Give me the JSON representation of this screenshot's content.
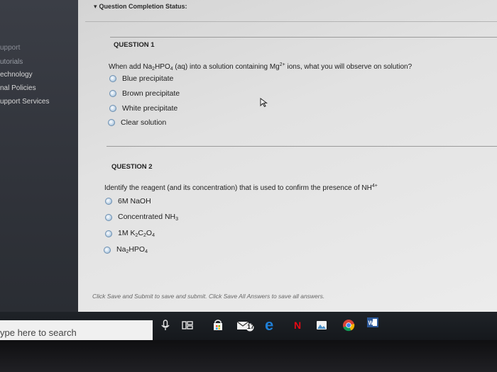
{
  "status": {
    "label": "Question Completion Status:"
  },
  "sidebar": {
    "items": [
      {
        "label": "upport"
      },
      {
        "label": "utorials"
      },
      {
        "label": "echnology"
      },
      {
        "label": "nal Policies"
      },
      {
        "label": "upport Services"
      }
    ]
  },
  "questions": [
    {
      "title": "QUESTION 1",
      "text_parts": [
        "When add Na",
        "2",
        "HPO",
        "4",
        " (aq) into a solution containing Mg",
        "2+",
        " ions, what you will observe on solution?"
      ],
      "options": [
        {
          "label": "Blue precipitate"
        },
        {
          "label": "Brown precipitate"
        },
        {
          "label": "White precipitate"
        },
        {
          "label": "Clear solution"
        }
      ]
    },
    {
      "title": "QUESTION 2",
      "text_parts": [
        "Identify the reagent (and its concentration) that is used to confirm the presence of NH",
        "4+"
      ],
      "options": [
        {
          "parts": [
            "6M NaOH"
          ]
        },
        {
          "parts": [
            "Concentrated NH",
            "3"
          ]
        },
        {
          "parts": [
            "1M K",
            "2",
            "C",
            "2",
            "O",
            "4"
          ]
        },
        {
          "parts": [
            "Na",
            "2",
            "HPO",
            "4"
          ]
        }
      ]
    }
  ],
  "footer": {
    "note": "Click Save and Submit to save and submit. Click Save All Answers to save all answers."
  },
  "taskbar": {
    "search_placeholder": "ype here to search",
    "icons": [
      "microphone-icon",
      "task-view-icon",
      "store-icon",
      "mail-icon",
      "edge-icon",
      "netflix-icon",
      "photos-icon",
      "chrome-icon",
      "word-icon"
    ],
    "badge_count": "17"
  },
  "colors": {
    "sidebar": "#30333a",
    "radio": "#7ea2c4",
    "edge": "#1f7fd6",
    "netflix": "#e50914",
    "word": "#2b5797"
  }
}
